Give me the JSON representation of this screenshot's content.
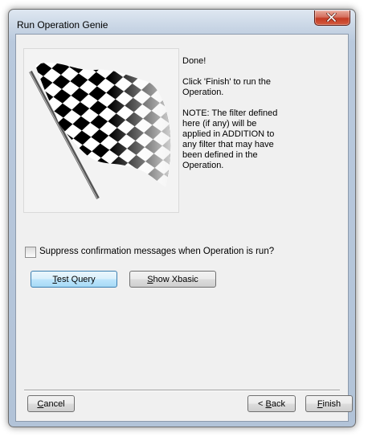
{
  "window": {
    "title": "Run Operation Genie"
  },
  "flag": {
    "icon": "checkered-flag-icon"
  },
  "message": {
    "line1": "Done!",
    "line2": "Click 'Finish' to run the Operation.",
    "line3": "NOTE: The filter defined here (if any) will be applied in ADDITION to any filter that may have been defined in the Operation."
  },
  "options": {
    "suppress_label": "Suppress confirmation messages when Operation is run?",
    "suppress_checked": false
  },
  "buttons": {
    "test_query_prefix": "",
    "test_query_key": "T",
    "test_query_rest": "est Query",
    "show_xbasic_prefix": "",
    "show_xbasic_key": "S",
    "show_xbasic_rest": "how Xbasic",
    "cancel_prefix": "",
    "cancel_key": "C",
    "cancel_rest": "ancel",
    "back_prefix": "< ",
    "back_key": "B",
    "back_rest": "ack",
    "finish_prefix": "",
    "finish_key": "F",
    "finish_rest": "inish"
  }
}
